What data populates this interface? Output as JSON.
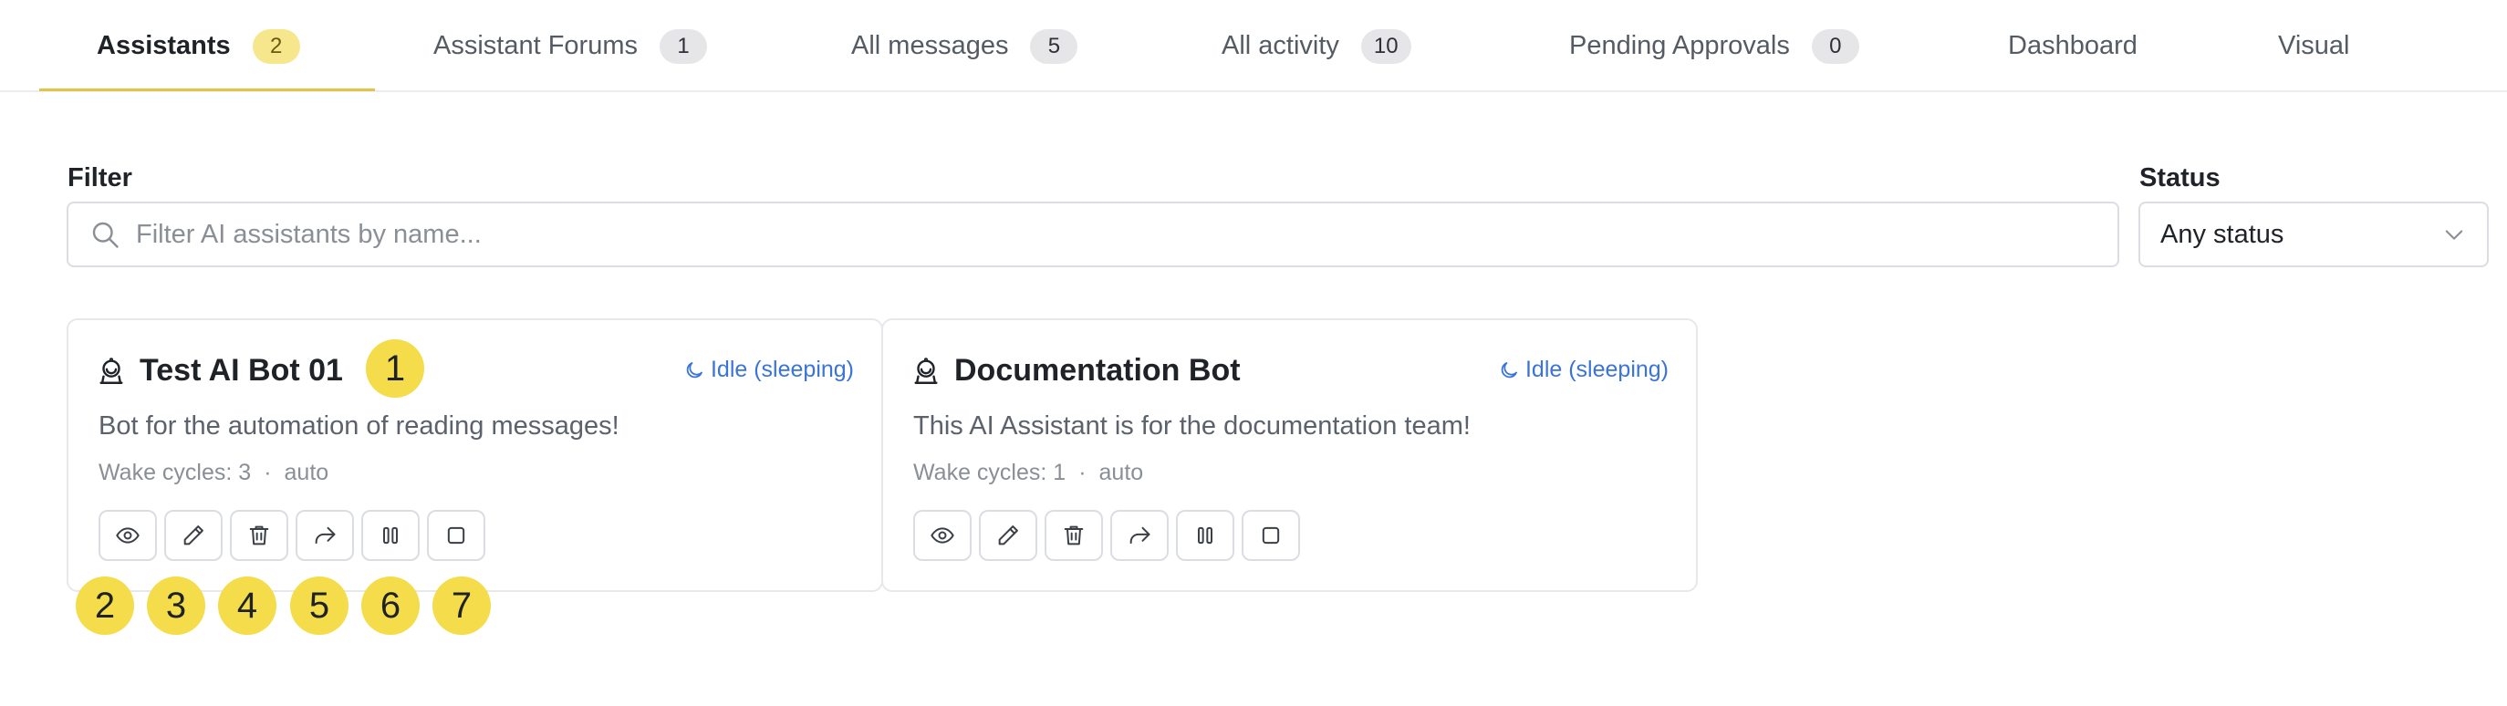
{
  "tabs": [
    {
      "label": "Assistants",
      "count": "2"
    },
    {
      "label": "Assistant Forums",
      "count": "1"
    },
    {
      "label": "All messages",
      "count": "5"
    },
    {
      "label": "All activity",
      "count": "10"
    },
    {
      "label": "Pending Approvals",
      "count": "0"
    },
    {
      "label": "Dashboard"
    },
    {
      "label": "Visual"
    }
  ],
  "filter": {
    "label": "Filter",
    "placeholder": "Filter AI assistants by name...",
    "value": ""
  },
  "status": {
    "label": "Status",
    "value": "Any status"
  },
  "cards": [
    {
      "name": "Test AI Bot 01",
      "status": "Idle (sleeping)",
      "description": "Bot for the automation of reading messages!",
      "wake_cycles": "Wake cycles: 3",
      "mode": "auto"
    },
    {
      "name": "Documentation Bot",
      "status": "Idle (sleeping)",
      "description": "This AI Assistant is for the documentation team!",
      "wake_cycles": "Wake cycles: 1",
      "mode": "auto"
    }
  ],
  "meta_separator": "·",
  "action_icons": [
    "view-icon",
    "edit-icon",
    "delete-icon",
    "share-icon",
    "pause-icon",
    "stop-icon"
  ],
  "markers": [
    "1",
    "2",
    "3",
    "4",
    "5",
    "6",
    "7"
  ],
  "colors": {
    "accent": "#e2c44a",
    "status_blue": "#3a74d8",
    "marker": "#f4dc4a"
  }
}
